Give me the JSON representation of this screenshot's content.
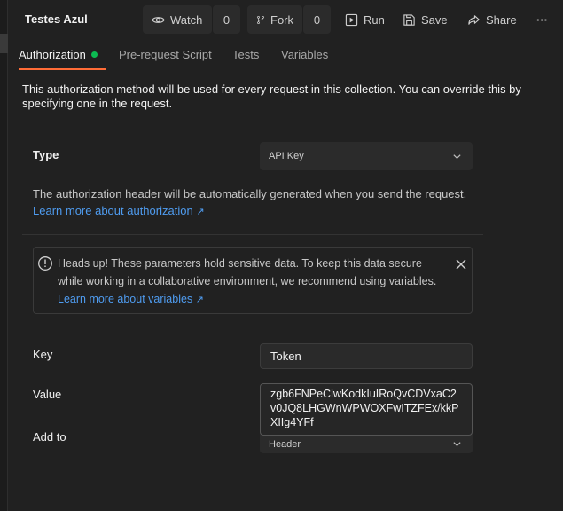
{
  "header": {
    "title": "Testes Azul",
    "watch_label": "Watch",
    "watch_count": "0",
    "fork_label": "Fork",
    "fork_count": "0",
    "run_label": "Run",
    "save_label": "Save",
    "share_label": "Share",
    "more_label": "···"
  },
  "tabs": [
    {
      "label": "Authorization",
      "active": true
    },
    {
      "label": "Pre-request Script"
    },
    {
      "label": "Tests"
    },
    {
      "label": "Variables"
    }
  ],
  "description": "This authorization method will be used for every request in this collection. You can override this by specifying one in the request.",
  "auth": {
    "type_label": "Type",
    "type_value": "API Key",
    "info_text": "The authorization header will be automatically generated when you send the request.",
    "learn_more": "Learn more about authorization",
    "link_arrow": "↗"
  },
  "alert": {
    "text": "Heads up! These parameters hold sensitive data. To keep this data secure while working in a collaborative environment, we recommend using variables.",
    "link": "Learn more about variables",
    "link_arrow": "↗"
  },
  "fields": {
    "key_label": "Key",
    "key_value": "Token",
    "value_label": "Value",
    "value_value": "zgb6FNPeClwKodkIuIRoQvCDVxaC2v0JQ8LHGWnWPWOXFwITZFEx/kkPXIIg4YFf",
    "addto_label": "Add to",
    "addto_value": "Header"
  },
  "colors": {
    "accent": "#ff6c37",
    "success_dot": "#0cbb52",
    "link": "#4f9cf0"
  }
}
